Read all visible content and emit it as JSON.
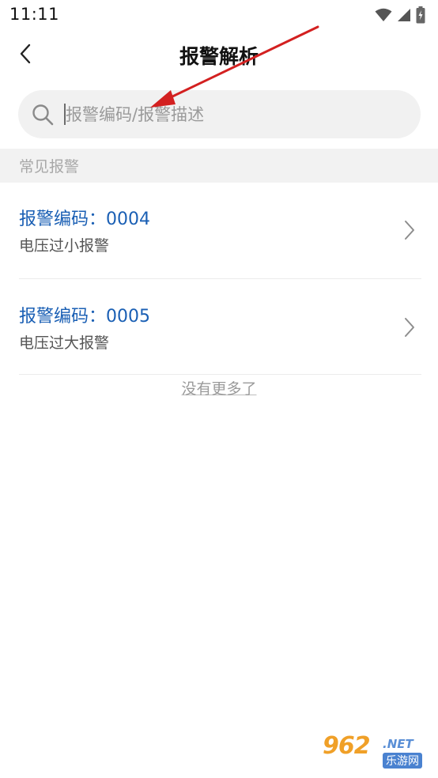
{
  "status_bar": {
    "time": "11:11",
    "icons": [
      "wifi-icon",
      "signal-icon",
      "battery-charging-icon"
    ]
  },
  "header": {
    "title": "报警解析",
    "back_icon": "chevron-left-icon"
  },
  "search": {
    "placeholder": "报警编码/报警描述",
    "value": "",
    "icon": "search-icon"
  },
  "section": {
    "title": "常见报警"
  },
  "alarms": [
    {
      "code_label": "报警编码：0004",
      "description": "电压过小报警"
    },
    {
      "code_label": "报警编码：0005",
      "description": "电压过大报警"
    }
  ],
  "list_footer": "没有更多了",
  "watermark": {
    "brand": "962",
    "domain": ".NET",
    "cn": "乐游网"
  },
  "colors": {
    "accent_blue": "#1a5fb4",
    "arrow_red": "#d32020",
    "section_bg": "#f2f2f2",
    "search_bg": "#f1f1f1"
  }
}
